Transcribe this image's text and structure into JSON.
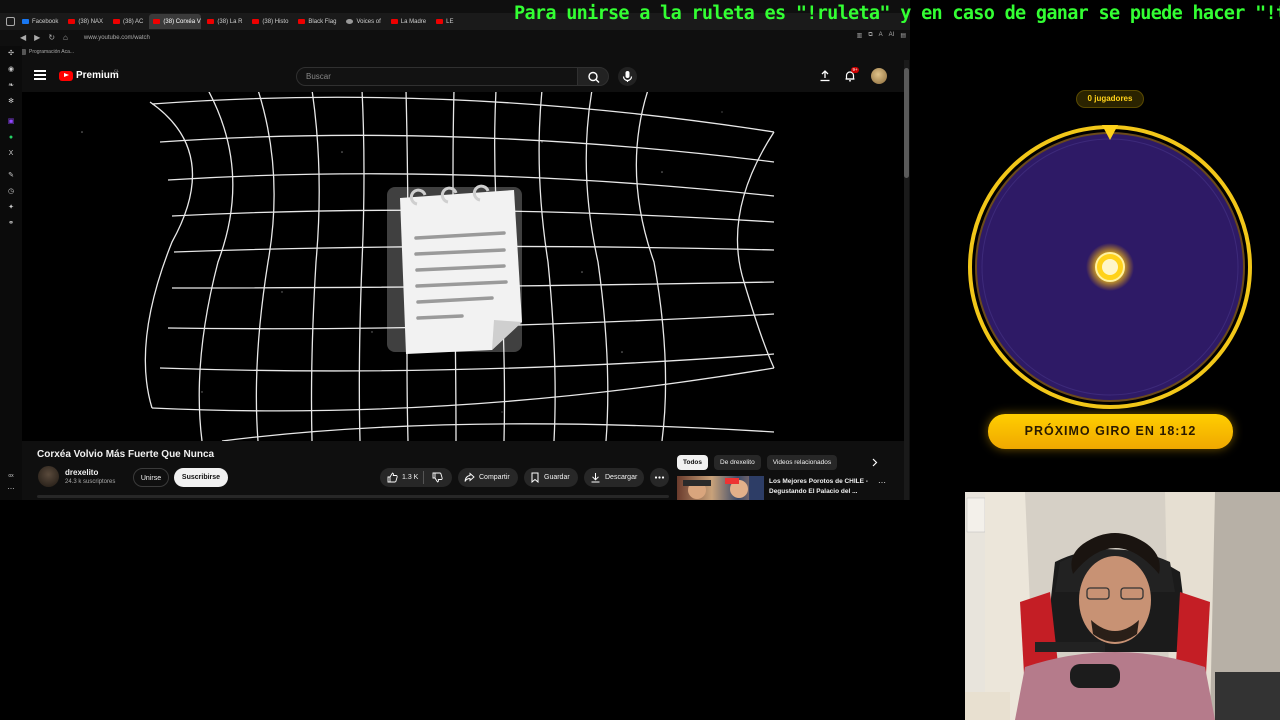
{
  "browser": {
    "tabs": [
      {
        "label": "Facebook",
        "favicon": "facebook-icon",
        "active": false
      },
      {
        "label": "(38) NAX",
        "favicon": "youtube-icon",
        "active": false
      },
      {
        "label": "(38) AC",
        "favicon": "youtube-icon",
        "active": false
      },
      {
        "label": "(38) Corxéa V",
        "favicon": "youtube-icon",
        "active": true
      },
      {
        "label": "(38) La R",
        "favicon": "youtube-icon",
        "active": false
      },
      {
        "label": "(38) Histo",
        "favicon": "youtube-icon",
        "active": false
      },
      {
        "label": "Black Flag",
        "favicon": "youtube-icon",
        "active": false
      },
      {
        "label": "Voices of",
        "favicon": "gear-icon",
        "active": false
      },
      {
        "label": "La Madre",
        "favicon": "youtube-icon",
        "active": false
      },
      {
        "label": "LE",
        "favicon": "youtube-icon",
        "active": false
      }
    ],
    "url": "www.youtube.com/watch",
    "bookmark_label": "Programación Aca...",
    "extensions_label": "AI"
  },
  "youtube": {
    "logo_text": "Premium",
    "country_code": "CL",
    "search_placeholder": "Buscar",
    "notification_count": "9+",
    "video": {
      "title": "Corxéa Volvio Más Fuerte Que Nunca",
      "channel": "drexelito",
      "subscribers": "24.3 k suscriptores",
      "join_label": "Unirse",
      "subscribe_label": "Suscribirse",
      "likes": "1.3 K",
      "share_label": "Compartir",
      "save_label": "Guardar",
      "download_label": "Descargar"
    },
    "chips": [
      "Todos",
      "De drexelito",
      "Videos relacionados"
    ],
    "recommendation": {
      "title": "Los Mejores Porotos de CHILE - Degustando El Palacio del ..."
    }
  },
  "overlay": {
    "ticker": "Para unirse a la ruleta es \"!ruleta\" y en caso de ganar se puede hacer \"!tortura\"",
    "players_badge": "0 jugadores",
    "spin_banner": "PRÓXIMO GIRO EN 18:12"
  },
  "colors": {
    "ticker": "#33ff33",
    "wheel_fill": "#2e1a66",
    "wheel_ring": "#ffd21a",
    "banner": "#ffc400",
    "youtube_red": "#ff0000"
  }
}
